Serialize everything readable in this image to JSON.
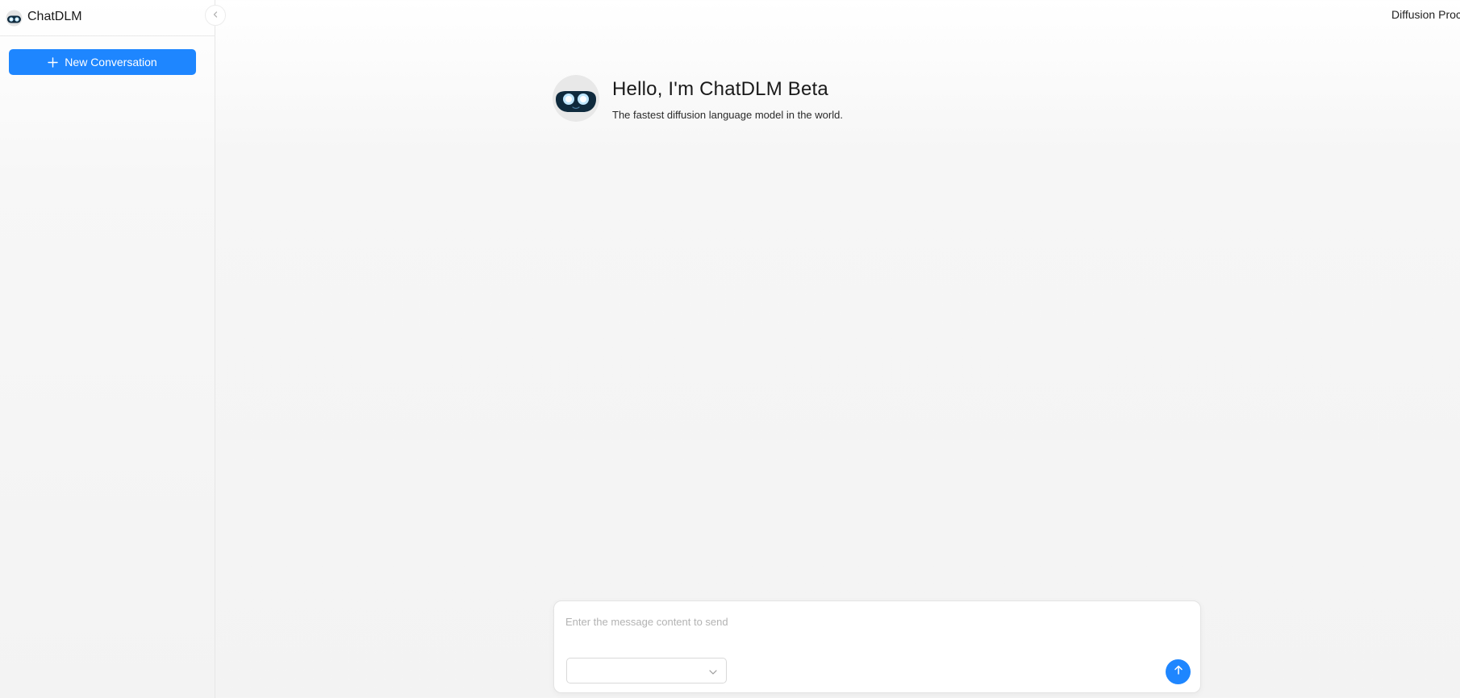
{
  "app": {
    "name": "ChatDLM",
    "logo_icon": "robot-face-icon"
  },
  "sidebar": {
    "collapse_icon": "chevron-left-icon",
    "new_conversation_label": "New Conversation",
    "new_conversation_icon": "plus-icon"
  },
  "header": {
    "right_text": "Diffusion Proc"
  },
  "greeting": {
    "title": "Hello, I'm ChatDLM Beta",
    "subtitle": "The fastest diffusion language model in the world.",
    "avatar_icon": "robot-face-icon"
  },
  "composer": {
    "placeholder": "Enter the message content to send",
    "value": "",
    "model_select_value": "",
    "send_icon": "arrow-up-icon"
  },
  "colors": {
    "accent": "#1e86ff",
    "robot_dark": "#0f2a3d",
    "robot_eye": "#bfe7ff"
  }
}
